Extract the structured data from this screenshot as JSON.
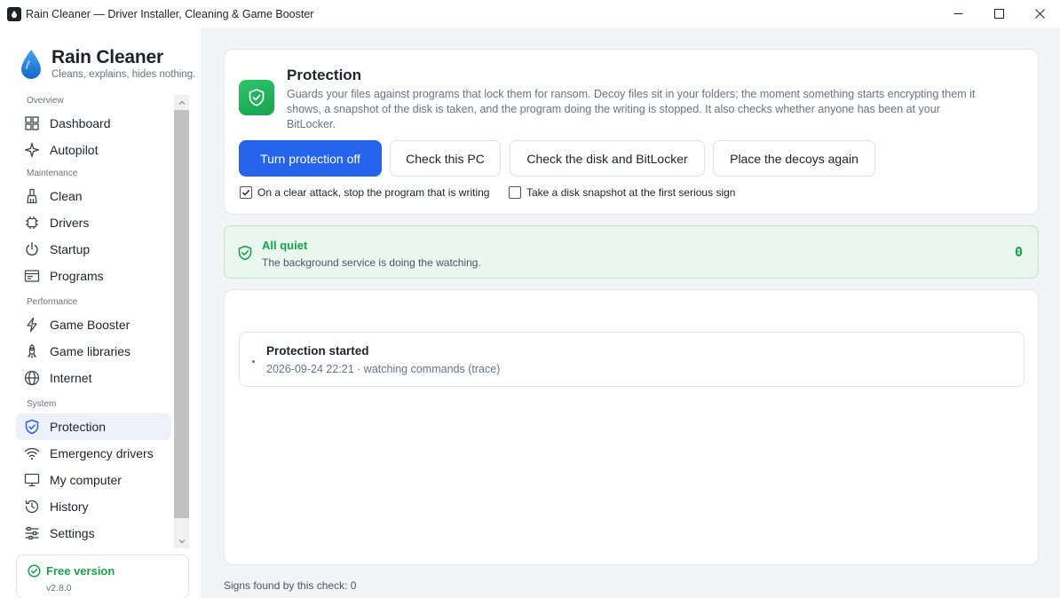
{
  "window": {
    "title": "Rain Cleaner — Driver Installer, Cleaning & Game Booster",
    "controls": [
      "minimize",
      "maximize",
      "close"
    ]
  },
  "brand": {
    "name": "Rain Cleaner",
    "tagline": "Cleans, explains, hides nothing.",
    "icon": "water-drop-icon",
    "color": "#1e88e5"
  },
  "sidebar": {
    "sections": [
      {
        "label": "Overview",
        "items": [
          {
            "label": "Dashboard",
            "icon": "grid-icon"
          },
          {
            "label": "Autopilot",
            "icon": "sparkle-icon"
          }
        ]
      },
      {
        "label": "Maintenance",
        "items": [
          {
            "label": "Clean",
            "icon": "broom-icon"
          },
          {
            "label": "Drivers",
            "icon": "chip-icon"
          },
          {
            "label": "Startup",
            "icon": "power-icon"
          },
          {
            "label": "Programs",
            "icon": "programs-icon"
          }
        ]
      },
      {
        "label": "Performance",
        "items": [
          {
            "label": "Game Booster",
            "icon": "lightning-icon"
          },
          {
            "label": "Game libraries",
            "icon": "rocket-icon"
          },
          {
            "label": "Internet",
            "icon": "globe-icon"
          }
        ]
      },
      {
        "label": "System",
        "items": [
          {
            "label": "Protection",
            "icon": "shield-icon",
            "active": true
          },
          {
            "label": "Emergency drivers",
            "icon": "wifi-icon"
          },
          {
            "label": "My computer",
            "icon": "monitor-icon"
          },
          {
            "label": "History",
            "icon": "history-icon"
          },
          {
            "label": "Settings",
            "icon": "sliders-icon"
          }
        ]
      }
    ],
    "version": {
      "status": "Free version",
      "number": "v2.8.0"
    }
  },
  "protection": {
    "title": "Protection",
    "description": "Guards your files against programs that lock them for ransom. Decoy files sit in your folders; the moment something starts encrypting them it shows, a snapshot of the disk is taken, and the program doing the writing is stopped. It also checks whether anyone has been at your BitLocker.",
    "buttons": {
      "toggle": "Turn protection off",
      "check_pc": "Check this PC",
      "check_disk": "Check the disk and BitLocker",
      "place_decoys": "Place the decoys again"
    },
    "options": {
      "stop_writer": {
        "label": "On a clear attack, stop the program that is writing",
        "checked": true
      },
      "disk_snapshot": {
        "label": "Take a disk snapshot at the first serious sign",
        "checked": false
      }
    }
  },
  "status": {
    "title": "All quiet",
    "subtitle": "The background service is doing the watching.",
    "count": "0"
  },
  "log": {
    "entries": [
      {
        "title": "Protection started",
        "meta": "2026-09-24 22:21 · watching commands (trace)"
      }
    ]
  },
  "footer": {
    "signs_found": "Signs found by this check: 0"
  },
  "colors": {
    "accent": "#2563eb",
    "success": "#16a34a",
    "status_bg": "#e9f7ef"
  }
}
